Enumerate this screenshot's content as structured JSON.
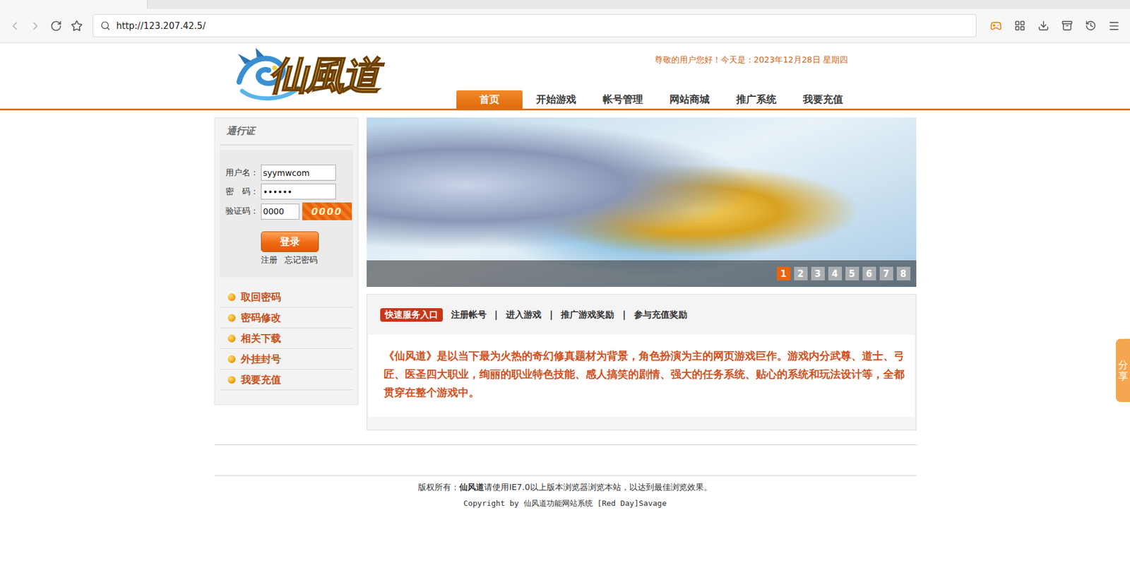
{
  "browser": {
    "url": "http://123.207.42.5/"
  },
  "header": {
    "logo": "仙風道",
    "greeting": "尊敬的用户您好！今天是：2023年12月28日 星期四",
    "nav": [
      {
        "label": "首页",
        "selected": true
      },
      {
        "label": "开始游戏",
        "selected": false
      },
      {
        "label": "帐号管理",
        "selected": false
      },
      {
        "label": "网站商城",
        "selected": false
      },
      {
        "label": "推广系统",
        "selected": false
      },
      {
        "label": "我要充值",
        "selected": false
      }
    ]
  },
  "login": {
    "title": "通行证",
    "fields": [
      {
        "label": "用户名：",
        "value": "syymwcom",
        "kind": "text"
      },
      {
        "label": "密　码：",
        "value": "••••••",
        "kind": "text"
      },
      {
        "label": "验证码：",
        "value": "0000",
        "kind": "captcha"
      }
    ],
    "captcha": "0000",
    "button": "登录",
    "links": [
      "注册",
      "忘记密码"
    ]
  },
  "sidebar": {
    "items": [
      "取回密码",
      "密码修改",
      "相关下载",
      "外挂封号",
      "我要充值"
    ]
  },
  "banner": {
    "pages": [
      {
        "label": "1",
        "selected": true
      },
      {
        "label": "2",
        "selected": false
      },
      {
        "label": "3",
        "selected": false
      },
      {
        "label": "4",
        "selected": false
      },
      {
        "label": "5",
        "selected": false
      },
      {
        "label": "6",
        "selected": false
      },
      {
        "label": "7",
        "selected": false
      },
      {
        "label": "8",
        "selected": false
      }
    ]
  },
  "quick": {
    "label": "快速服务入口",
    "links": [
      "注册帐号",
      "进入游戏",
      "推广游戏奖励",
      "参与充值奖励"
    ],
    "separator": "|",
    "description": "《仙风道》是以当下最为火热的奇幻修真题材为背景，角色扮演为主的网页游戏巨作。游戏内分武尊、道士、弓匠、医圣四大职业，绚丽的职业特色技能、感人搞笑的剧情、强大的任务系统、贴心的系统和玩法设计等，全都贯穿在整个游戏中。"
  },
  "footer": {
    "prefix": "版权所有：",
    "bold": "仙风道",
    "rest": "请使用IE7.0以上版本浏览器浏览本站，以达到最佳浏览效果。",
    "copyright": "Copyright by 仙风道功能网站系统 [Red Day]Savage"
  },
  "share": "分享"
}
